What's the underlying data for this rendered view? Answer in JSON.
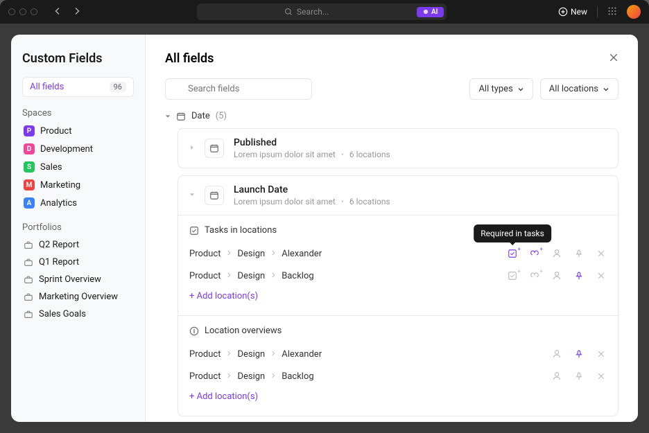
{
  "titlebar": {
    "search_placeholder": "Search...",
    "ai_label": "AI",
    "new_label": "New"
  },
  "sidebar": {
    "title": "Custom Fields",
    "all_fields_label": "All fields",
    "all_fields_count": "96",
    "spaces_label": "Spaces",
    "spaces": [
      {
        "letter": "P",
        "color": "#7c3aed",
        "name": "Product"
      },
      {
        "letter": "D",
        "color": "#ec4899",
        "name": "Development"
      },
      {
        "letter": "S",
        "color": "#22c55e",
        "name": "Sales"
      },
      {
        "letter": "M",
        "color": "#ef4444",
        "name": "Marketing"
      },
      {
        "letter": "A",
        "color": "#3b82f6",
        "name": "Analytics"
      }
    ],
    "portfolios_label": "Portfolios",
    "portfolios": [
      "Q2 Report",
      "Q1 Report",
      "Sprint Overview",
      "Marketing Overview",
      "Sales Goals"
    ]
  },
  "main": {
    "title": "All fields",
    "search_placeholder": "Search fields",
    "filter_types": "All types",
    "filter_locations": "All locations",
    "group": {
      "name": "Date",
      "count": "(5)"
    },
    "fields": [
      {
        "name": "Published",
        "desc": "Lorem ipsum dolor sit amet",
        "locations": "6 locations"
      },
      {
        "name": "Launch Date",
        "desc": "Lorem ipsum dolor sit amet",
        "locations": "6 locations"
      }
    ],
    "tasks_section_label": "Tasks in locations",
    "overviews_section_label": "Location overviews",
    "breadcrumb_items": [
      "Product",
      "Design",
      "Alexander"
    ],
    "breadcrumb_items2": [
      "Product",
      "Design",
      "Backlog"
    ],
    "add_locations_label": "+ Add location(s)",
    "tooltip_text": "Required in tasks"
  }
}
